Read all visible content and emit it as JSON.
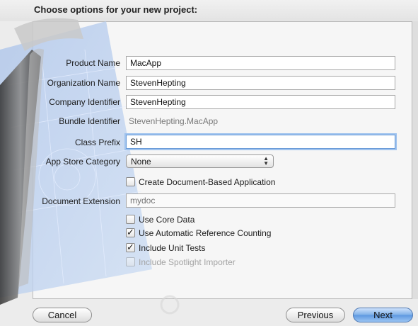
{
  "title": "Choose options for your new project:",
  "fields": {
    "product_name": {
      "label": "Product Name",
      "value": "MacApp"
    },
    "organization_name": {
      "label": "Organization Name",
      "value": "StevenHepting"
    },
    "company_identifier": {
      "label": "Company Identifier",
      "value": "StevenHepting"
    },
    "bundle_identifier": {
      "label": "Bundle Identifier",
      "value": "StevenHepting.MacApp"
    },
    "class_prefix": {
      "label": "Class Prefix",
      "value": "SH"
    },
    "app_store_category": {
      "label": "App Store Category",
      "value": "None"
    },
    "document_extension": {
      "label": "Document Extension",
      "placeholder": "mydoc"
    }
  },
  "checkboxes": {
    "document_based": {
      "label": "Create Document-Based Application",
      "checked": false
    },
    "core_data": {
      "label": "Use Core Data",
      "checked": false
    },
    "arc": {
      "label": "Use Automatic Reference Counting",
      "checked": true
    },
    "unit_tests": {
      "label": "Include Unit Tests",
      "checked": true
    },
    "spotlight": {
      "label": "Include Spotlight Importer",
      "checked": false,
      "disabled": true
    }
  },
  "buttons": {
    "cancel": "Cancel",
    "previous": "Previous",
    "next": "Next"
  },
  "icons": {
    "checkmark": "✓",
    "popup_arrows": "▲▼"
  }
}
